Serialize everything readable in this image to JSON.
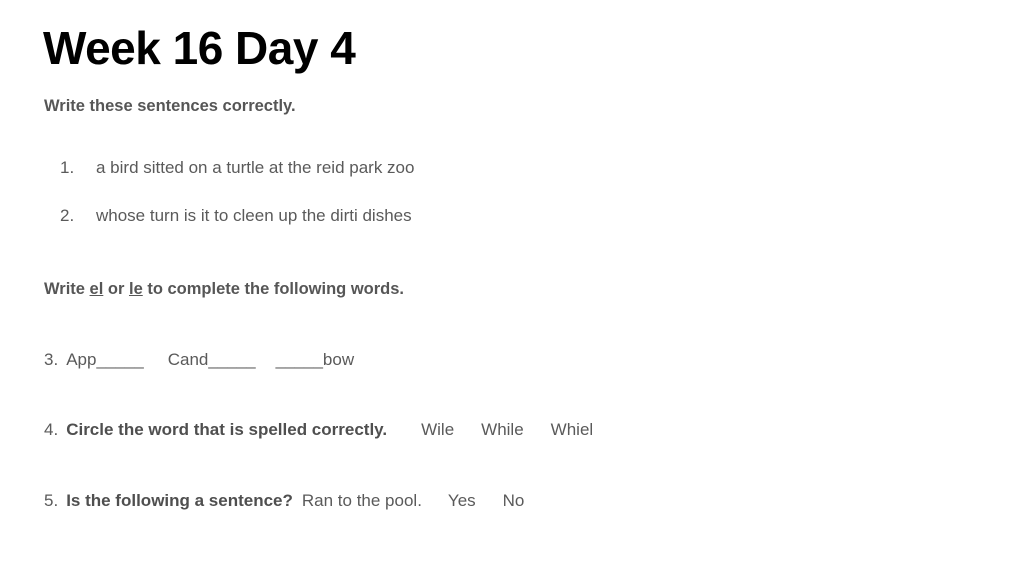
{
  "document": {
    "title": "Week 16 Day 4",
    "background_color": "#ffffff",
    "title_color": "#000000",
    "body_text_color": "#5a5a5a"
  },
  "sections": {
    "instruction_1": {
      "text": "Write these sentences correctly."
    },
    "sentences": [
      {
        "number": "1.",
        "text": "a bird sitted on a turtle at the reid park zoo"
      },
      {
        "number": "2.",
        "text": "whose turn is it to cleen up the dirti dishes"
      }
    ],
    "instruction_2": {
      "prefix": "Write ",
      "underlined_1": "el",
      "middle": " or ",
      "underlined_2": "le",
      "suffix": " to complete the following words."
    },
    "exercise_3": {
      "number": "3.",
      "word_1": "App",
      "blank_1": "_____",
      "word_2": "Cand",
      "blank_2": "_____",
      "blank_3": "_____",
      "word_3": "bow"
    },
    "exercise_4": {
      "number": "4.",
      "prompt": "Circle the word that is spelled correctly.",
      "choices": [
        "Wile",
        "While",
        "Whiel"
      ]
    },
    "exercise_5": {
      "number": "5.",
      "prompt": "Is the following a sentence?",
      "sentence": "Ran to the pool.",
      "choices": [
        "Yes",
        "No"
      ]
    }
  }
}
